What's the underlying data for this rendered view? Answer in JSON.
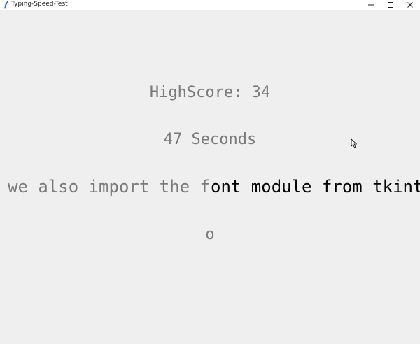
{
  "window": {
    "title": "Typing-Speed-Test"
  },
  "game": {
    "highscore": "HighScore: 34",
    "timer": "47 Seconds",
    "typed_text": "we also import the f",
    "remaining_text": "ont module from tkinter",
    "current_char": "o"
  },
  "colors": {
    "background": "#f0eff0",
    "typed": "#7a7a7a",
    "remaining": "#000000"
  }
}
